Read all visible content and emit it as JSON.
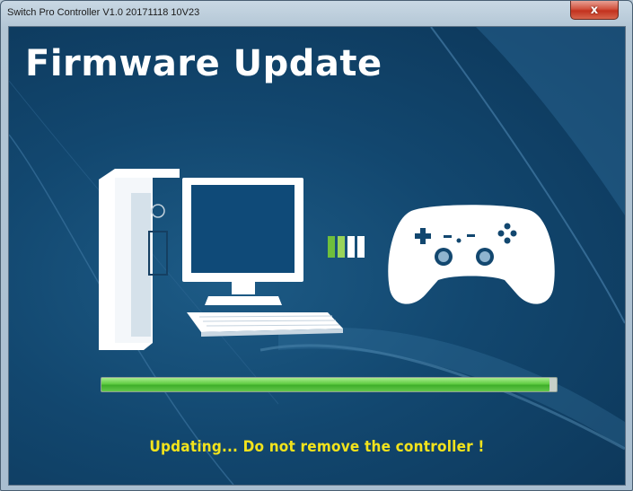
{
  "window": {
    "title": "Switch Pro Controller V1.0 20171118 10V23",
    "close_label": "x"
  },
  "main": {
    "heading": "Firmware Update",
    "progress_fraction": 0.985,
    "status_text": "Updating... Do not remove the controller !"
  },
  "icons": [
    "computer-icon",
    "transfer-bars-icon",
    "gamepad-icon",
    "close-icon"
  ],
  "colors": {
    "background": "#12476f",
    "progress": "#5fcc42",
    "status_text": "#f2e31c",
    "transfer_active": "#8fd14a"
  }
}
